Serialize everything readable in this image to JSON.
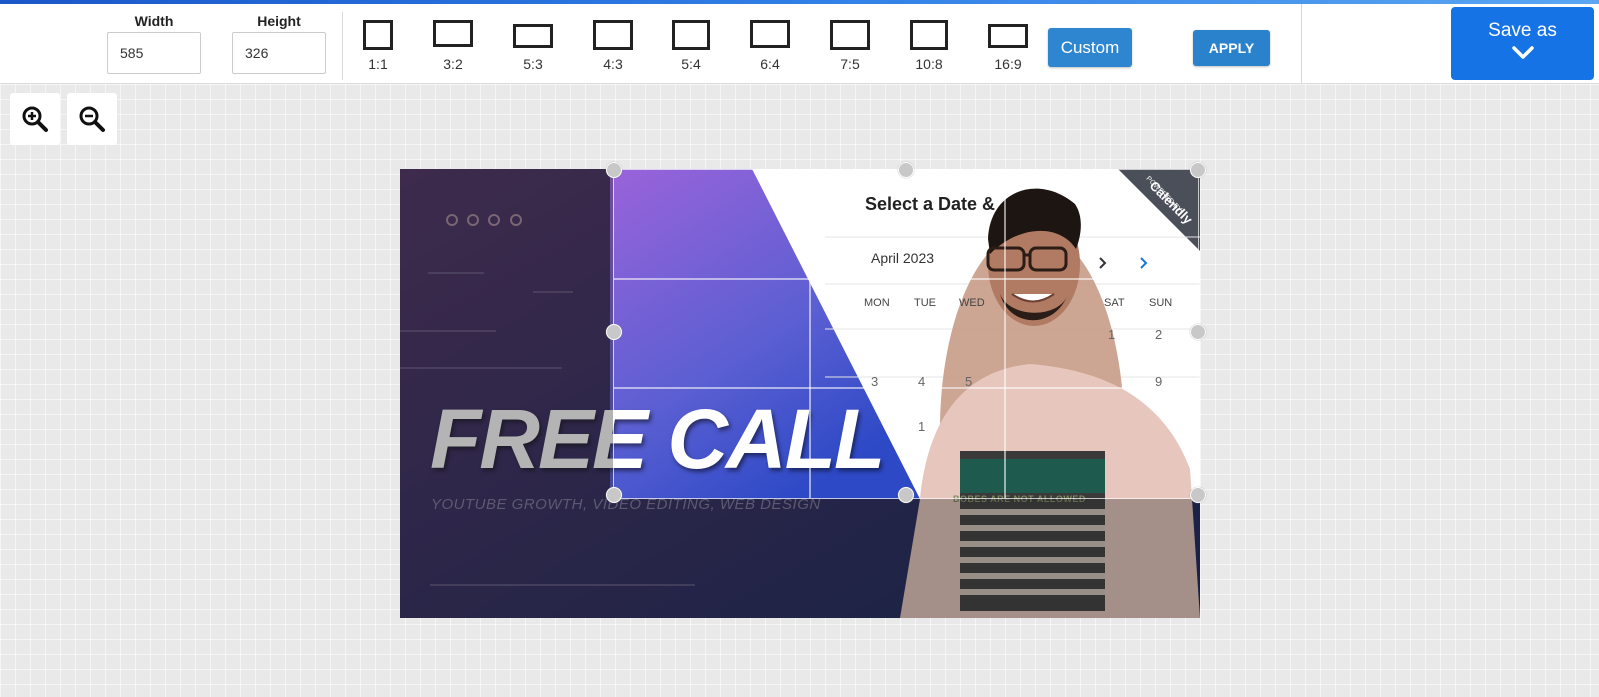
{
  "toolbar": {
    "width_label": "Width",
    "width_value": "585",
    "height_label": "Height",
    "height_value": "326",
    "ratios": [
      "1:1",
      "3:2",
      "5:3",
      "4:3",
      "5:4",
      "6:4",
      "7:5",
      "10:8",
      "16:9"
    ],
    "custom_label": "Custom",
    "apply_label": "APPLY"
  },
  "save": {
    "label": "Save as"
  },
  "zoom": {
    "in_icon": "zoom-in-icon",
    "out_icon": "zoom-out-icon"
  },
  "image": {
    "headline": "FREE CALL",
    "subline": "YOUTUBE GROWTH, VIDEO EDITING, WEB DESIGN",
    "calendar_title": "Select a Date &",
    "month": "April 2023",
    "badge_small": "POWERED BY",
    "badge_brand": "Calendly",
    "weekdays": [
      "MON",
      "TUE",
      "WED",
      "SAT",
      "SUN"
    ],
    "days": [
      "1",
      "2",
      "3",
      "4",
      "5",
      "9",
      "1"
    ],
    "shirt_text": "BOBES ARE NOT ALLOWED"
  },
  "colors": {
    "accent": "#1673e5",
    "button": "#2e86d0",
    "headline": "#ffffff"
  }
}
